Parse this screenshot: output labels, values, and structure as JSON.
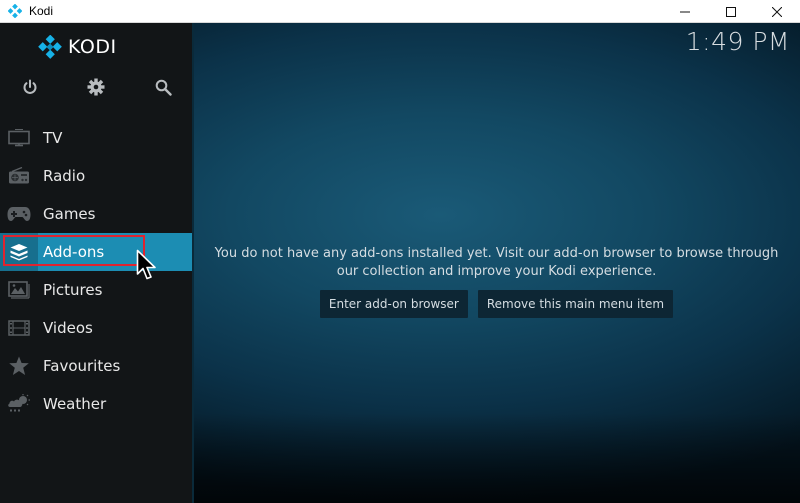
{
  "window": {
    "title": "Kodi",
    "controls": {
      "minimize": "—",
      "maximize": "☐",
      "close": "✕"
    }
  },
  "logo": {
    "text": "KODI"
  },
  "clock": "1:49 PM",
  "top_icons": [
    "power-icon",
    "gear-icon",
    "search-icon"
  ],
  "menu": {
    "items": [
      {
        "label": "TV",
        "icon": "tv-icon"
      },
      {
        "label": "Radio",
        "icon": "radio-icon"
      },
      {
        "label": "Games",
        "icon": "gamepad-icon"
      },
      {
        "label": "Add-ons",
        "icon": "addons-box-icon",
        "active": true
      },
      {
        "label": "Pictures",
        "icon": "pictures-icon"
      },
      {
        "label": "Videos",
        "icon": "film-icon"
      },
      {
        "label": "Favourites",
        "icon": "star-icon"
      },
      {
        "label": "Weather",
        "icon": "weather-icon"
      }
    ]
  },
  "content": {
    "message_line1": "You do not have any add-ons installed yet. Visit our add-on browser to browse through",
    "message_line2": "our collection and improve your Kodi experience.",
    "buttons": {
      "enter_browser": "Enter add-on browser",
      "remove_item": "Remove this main menu item"
    }
  },
  "colors": {
    "accent": "#1c8db3",
    "sidebar": "#121517",
    "highlight_border": "#e0242f",
    "kodi_blue": "#17b2e7"
  }
}
